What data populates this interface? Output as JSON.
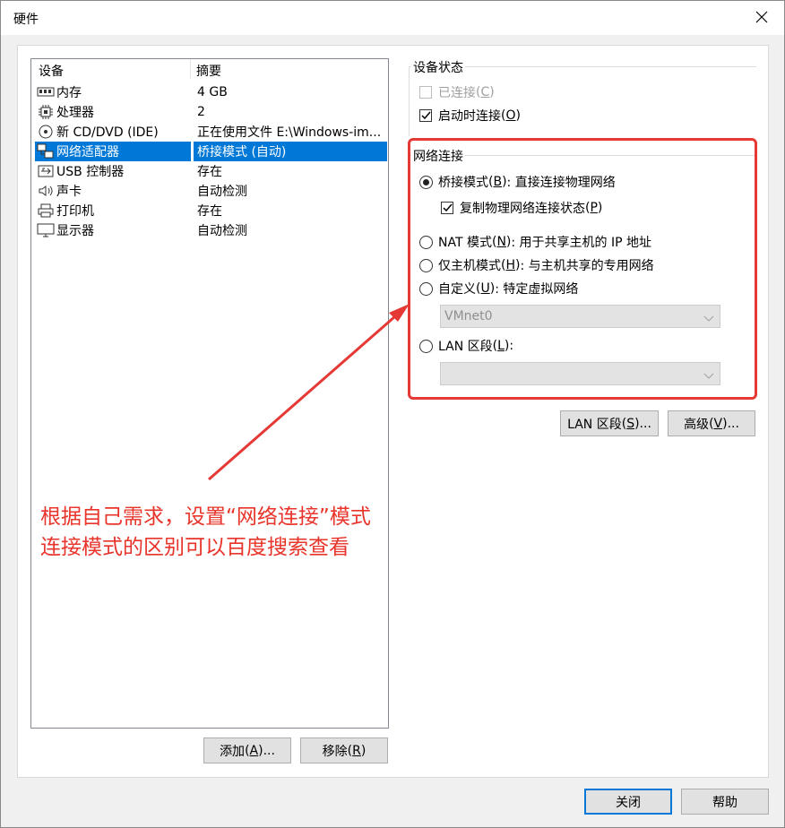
{
  "window": {
    "title": "硬件",
    "close_icon": "close-icon"
  },
  "device_list": {
    "headers": {
      "device": "设备",
      "summary": "摘要"
    },
    "rows": [
      {
        "icon": "memory-icon",
        "name": "内存",
        "summary": "4 GB"
      },
      {
        "icon": "cpu-icon",
        "name": "处理器",
        "summary": "2"
      },
      {
        "icon": "cd-icon",
        "name": "新 CD/DVD (IDE)",
        "summary": "正在使用文件 E:\\Windows-im..."
      },
      {
        "icon": "network-icon",
        "name": "网络适配器",
        "summary": "桥接模式 (自动)",
        "selected": true
      },
      {
        "icon": "usb-icon",
        "name": "USB 控制器",
        "summary": "存在"
      },
      {
        "icon": "speaker-icon",
        "name": "声卡",
        "summary": "自动检测"
      },
      {
        "icon": "printer-icon",
        "name": "打印机",
        "summary": "存在"
      },
      {
        "icon": "monitor-icon",
        "name": "显示器",
        "summary": "自动检测"
      }
    ]
  },
  "list_buttons": {
    "add": "添加",
    "add_key": "A",
    "add_suffix": "...",
    "remove": "移除",
    "remove_key": "R"
  },
  "device_status": {
    "label": "设备状态",
    "connected": {
      "label": "已连接",
      "key": "C",
      "checked": false,
      "enabled": false
    },
    "connect_at_power_on": {
      "label": "启动时连接",
      "key": "O",
      "checked": true
    }
  },
  "network_connection": {
    "label": "网络连接",
    "bridged": {
      "label": "桥接模式",
      "key": "B",
      "desc": ": 直接连接物理网络",
      "selected": true
    },
    "replicate": {
      "label": "复制物理网络连接状态",
      "key": "P",
      "checked": true
    },
    "nat": {
      "label": "NAT 模式",
      "key": "N",
      "desc": ": 用于共享主机的 IP 地址"
    },
    "host_only": {
      "label": "仅主机模式",
      "key": "H",
      "desc": ": 与主机共享的专用网络"
    },
    "custom": {
      "label": "自定义",
      "key": "U",
      "desc": ": 特定虚拟网络"
    },
    "custom_value": "VMnet0",
    "lan_segment": {
      "label": "LAN 区段",
      "key": "L",
      "desc": ":"
    },
    "lan_value": ""
  },
  "action_buttons": {
    "lan_segments": {
      "label": "LAN 区段",
      "key": "S",
      "suffix": "..."
    },
    "advanced": {
      "label": "高级",
      "key": "V",
      "suffix": "..."
    }
  },
  "footer": {
    "close": "关闭",
    "help": "帮助"
  },
  "annotation": {
    "line1": "根据自己需求，设置“网络连接”模式",
    "line2": "连接模式的区别可以百度搜索查看",
    "color": "#e8342a"
  }
}
